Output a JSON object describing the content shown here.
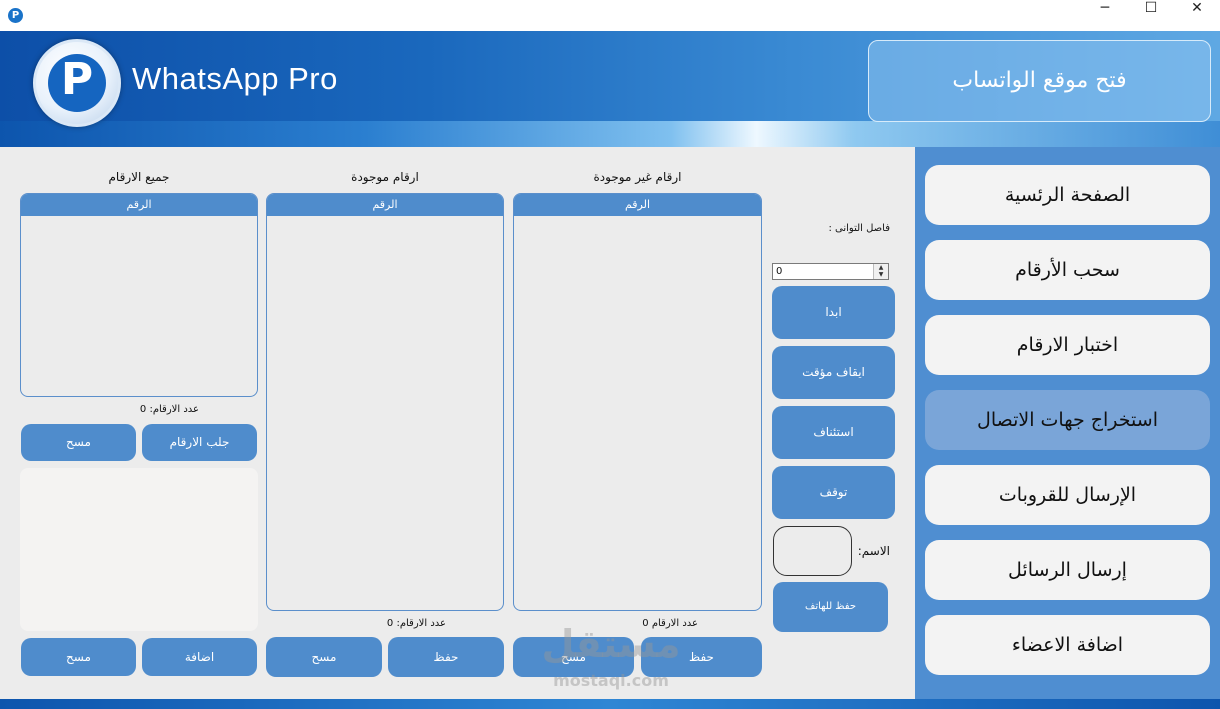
{
  "window": {
    "app_icon_letter": "P",
    "minimize_glyph": "─",
    "maximize_glyph": "☐",
    "close_glyph": "✕"
  },
  "header": {
    "logo_letter": "P",
    "brand": "WhatsApp Pro",
    "open_site_label": "فتح موقع الواتساب"
  },
  "sidebar": {
    "items": [
      {
        "label": "الصفحة الرئسية",
        "active": false
      },
      {
        "label": "سحب الأرقام",
        "active": false
      },
      {
        "label": "اختبار الارقام",
        "active": false
      },
      {
        "label": "استخراج جهات الاتصال",
        "active": true
      },
      {
        "label": "الإرسال للقروبات",
        "active": false
      },
      {
        "label": "إرسال الرسائل",
        "active": false
      },
      {
        "label": "اضافة الاعضاء",
        "active": false
      }
    ]
  },
  "columns": {
    "all": {
      "title": "جميع الارقام",
      "header": "الرقم",
      "count_label": "عدد الارقام:",
      "count": "0",
      "clear_label": "مسح",
      "fetch_label": "جلب الارقام",
      "bottom_clear_label": "مسح",
      "add_label": "اضافة"
    },
    "existing": {
      "title": "ارقام موجودة",
      "header": "الرقم",
      "count_label": "عدد الارقام:",
      "count": "0",
      "clear_label": "مسح",
      "save_label": "حفظ"
    },
    "missing": {
      "title": "ارقام غير موجودة",
      "header": "الرقم",
      "count_label": "عدد الارقام",
      "count": "0",
      "clear_label": "مسح",
      "save_label": "حفظ"
    }
  },
  "controls": {
    "interval_label": "فاصل التوانى :",
    "interval_value": "0",
    "start_label": "ابدا",
    "pause_label": "ايقاف مؤقت",
    "resume_label": "استئناف",
    "stop_label": "توقف",
    "name_label": "الاسم:",
    "name_value": "",
    "save_phone_label": "حفظ للهاتف"
  },
  "watermark": {
    "text": "مستقل",
    "sub": "mostaql.com"
  }
}
